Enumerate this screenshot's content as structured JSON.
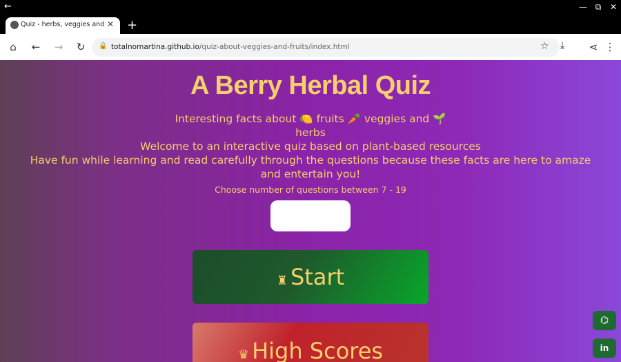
{
  "browser": {
    "tab_title": "Quiz - herbs, veggies and fruits",
    "url_host": "totalnomartina.github.io",
    "url_path": "/quiz-about-veggies-and-fruits/index.html",
    "icons": {
      "back": "←",
      "forward": "→",
      "reload": "↻",
      "home": "⌂",
      "star": "☆",
      "download": "⤓",
      "share": "⋖",
      "menu": "⋮",
      "lock": "🔒",
      "newtab": "+",
      "close": "✕",
      "minimize": "—",
      "restore": "⧉",
      "winclose": "✕",
      "titleback": "←"
    }
  },
  "page": {
    "title": "A Berry Herbal Quiz",
    "intro_part1": "Interesting facts about ",
    "intro_emoji1": "🍋",
    "intro_part2": " fruits ",
    "intro_emoji2": "🥕",
    "intro_part3": " veggies and ",
    "intro_emoji3": "🌱",
    "intro_part4": " herbs",
    "welcome": "Welcome to an interactive quiz based on plant-based resources",
    "have_fun": "Have fun while learning and read carefully through the questions because these facts are here to amaze and entertain you!",
    "choose_label": "Choose number of questions between 7 - 19",
    "start_icon": "♜",
    "start_label": "Start",
    "scores_icon": "♛",
    "scores_label": "High Scores",
    "github_icon": "⌬",
    "linkedin_icon": "in"
  },
  "colors": {
    "accent_text": "#f6cf6d",
    "start_button": "#09a62a",
    "scores_button": "#c0222c",
    "social_button": "#1f6a31"
  }
}
